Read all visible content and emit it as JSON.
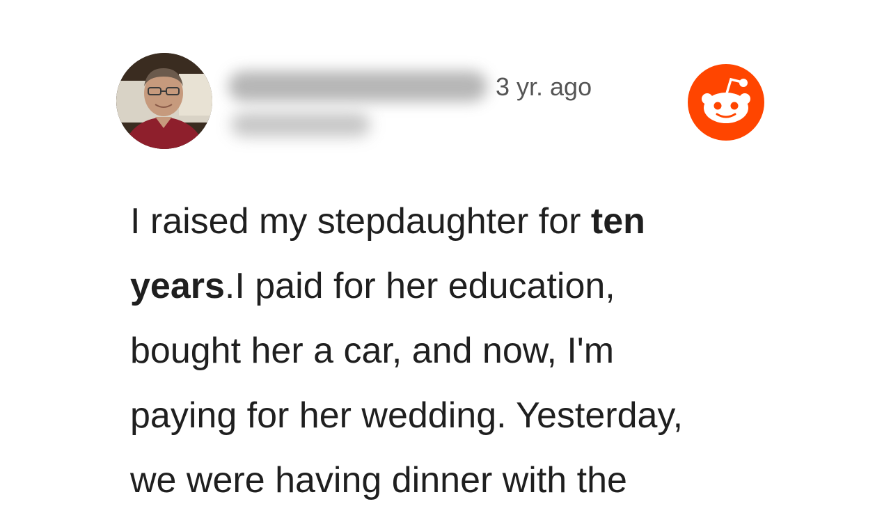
{
  "post": {
    "timestamp": "3 yr. ago",
    "body_lines": [
      {
        "pre": "I raised my stepdaughter for ",
        "bold": "ten",
        "post": ""
      },
      {
        "pre": "",
        "bold": "years",
        "post": ".I paid for her education,"
      },
      {
        "pre": "bought her a car, and now, I'm",
        "bold": "",
        "post": ""
      },
      {
        "pre": "paying for her wedding. Yesterday,",
        "bold": "",
        "post": ""
      },
      {
        "pre": "we were having dinner with the",
        "bold": "",
        "post": ""
      }
    ]
  },
  "icons": {
    "avatar": "user-avatar-photo",
    "brand": "reddit-logo-icon"
  },
  "colors": {
    "reddit_orange": "#FF4500",
    "timestamp": "#555555",
    "text": "#1f1f1f"
  }
}
